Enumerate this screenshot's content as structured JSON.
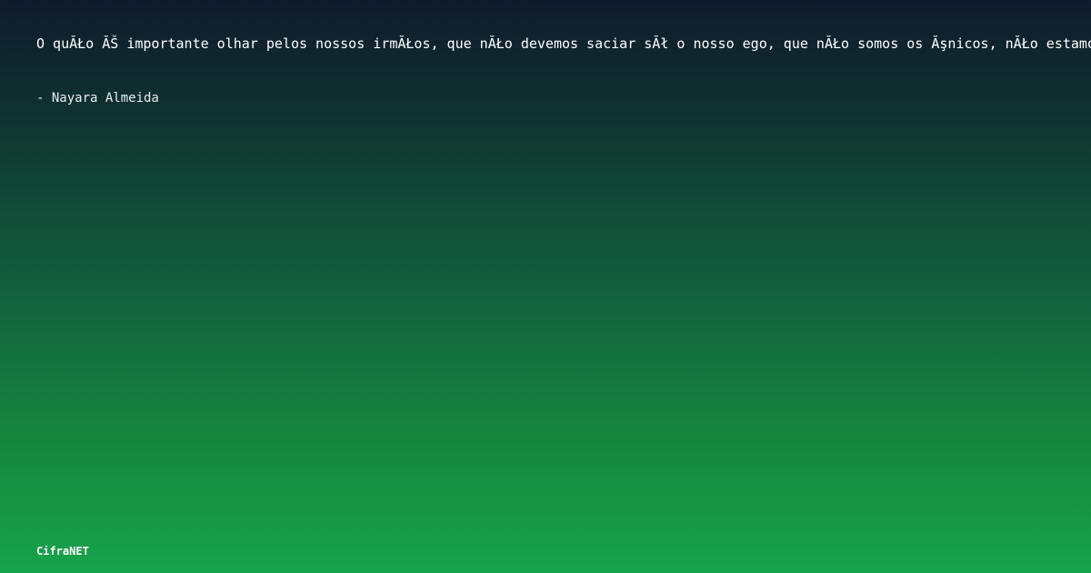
{
  "quote": {
    "text": "O quĂŁo ĂŠ importante olhar pelos nossos irmĂŁos, que nĂŁo devemos saciar sĂł o nosso ego, que nĂŁo somos os Ăşnicos, nĂŁo estamos",
    "author": "- Nayara Almeida"
  },
  "brand": {
    "name": "CifraNET"
  },
  "colors": {
    "gradient_top": "#0f1a2c",
    "gradient_bottom": "#16a34a",
    "text": "#ffffff"
  }
}
